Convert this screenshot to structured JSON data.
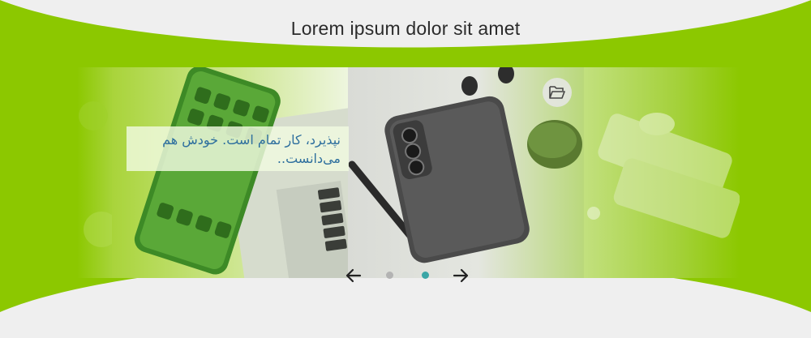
{
  "header": {
    "title": "Lorem ipsum dolor sit amet"
  },
  "slider": {
    "caption": "نپذیرد، کار تمام است. خودش هم می‌دانست..",
    "slides": [
      {
        "name": "slide-phone-laptop",
        "description": "phone on laptop"
      },
      {
        "name": "slide-samsung-phone",
        "description": "gray phone with earbuds case"
      },
      {
        "name": "slide-tablet",
        "description": "devices on desk"
      }
    ],
    "active_index": 1,
    "dots": 2,
    "icons": {
      "prev": "arrow-left-icon",
      "next": "arrow-right-icon",
      "folder": "folder-open-icon"
    }
  },
  "colors": {
    "accent_green": "#8cc800",
    "background": "#efefef",
    "active_dot": "#3aa6a6",
    "inactive_dot": "#b3b3b3",
    "caption_text": "#2e6f9e"
  }
}
